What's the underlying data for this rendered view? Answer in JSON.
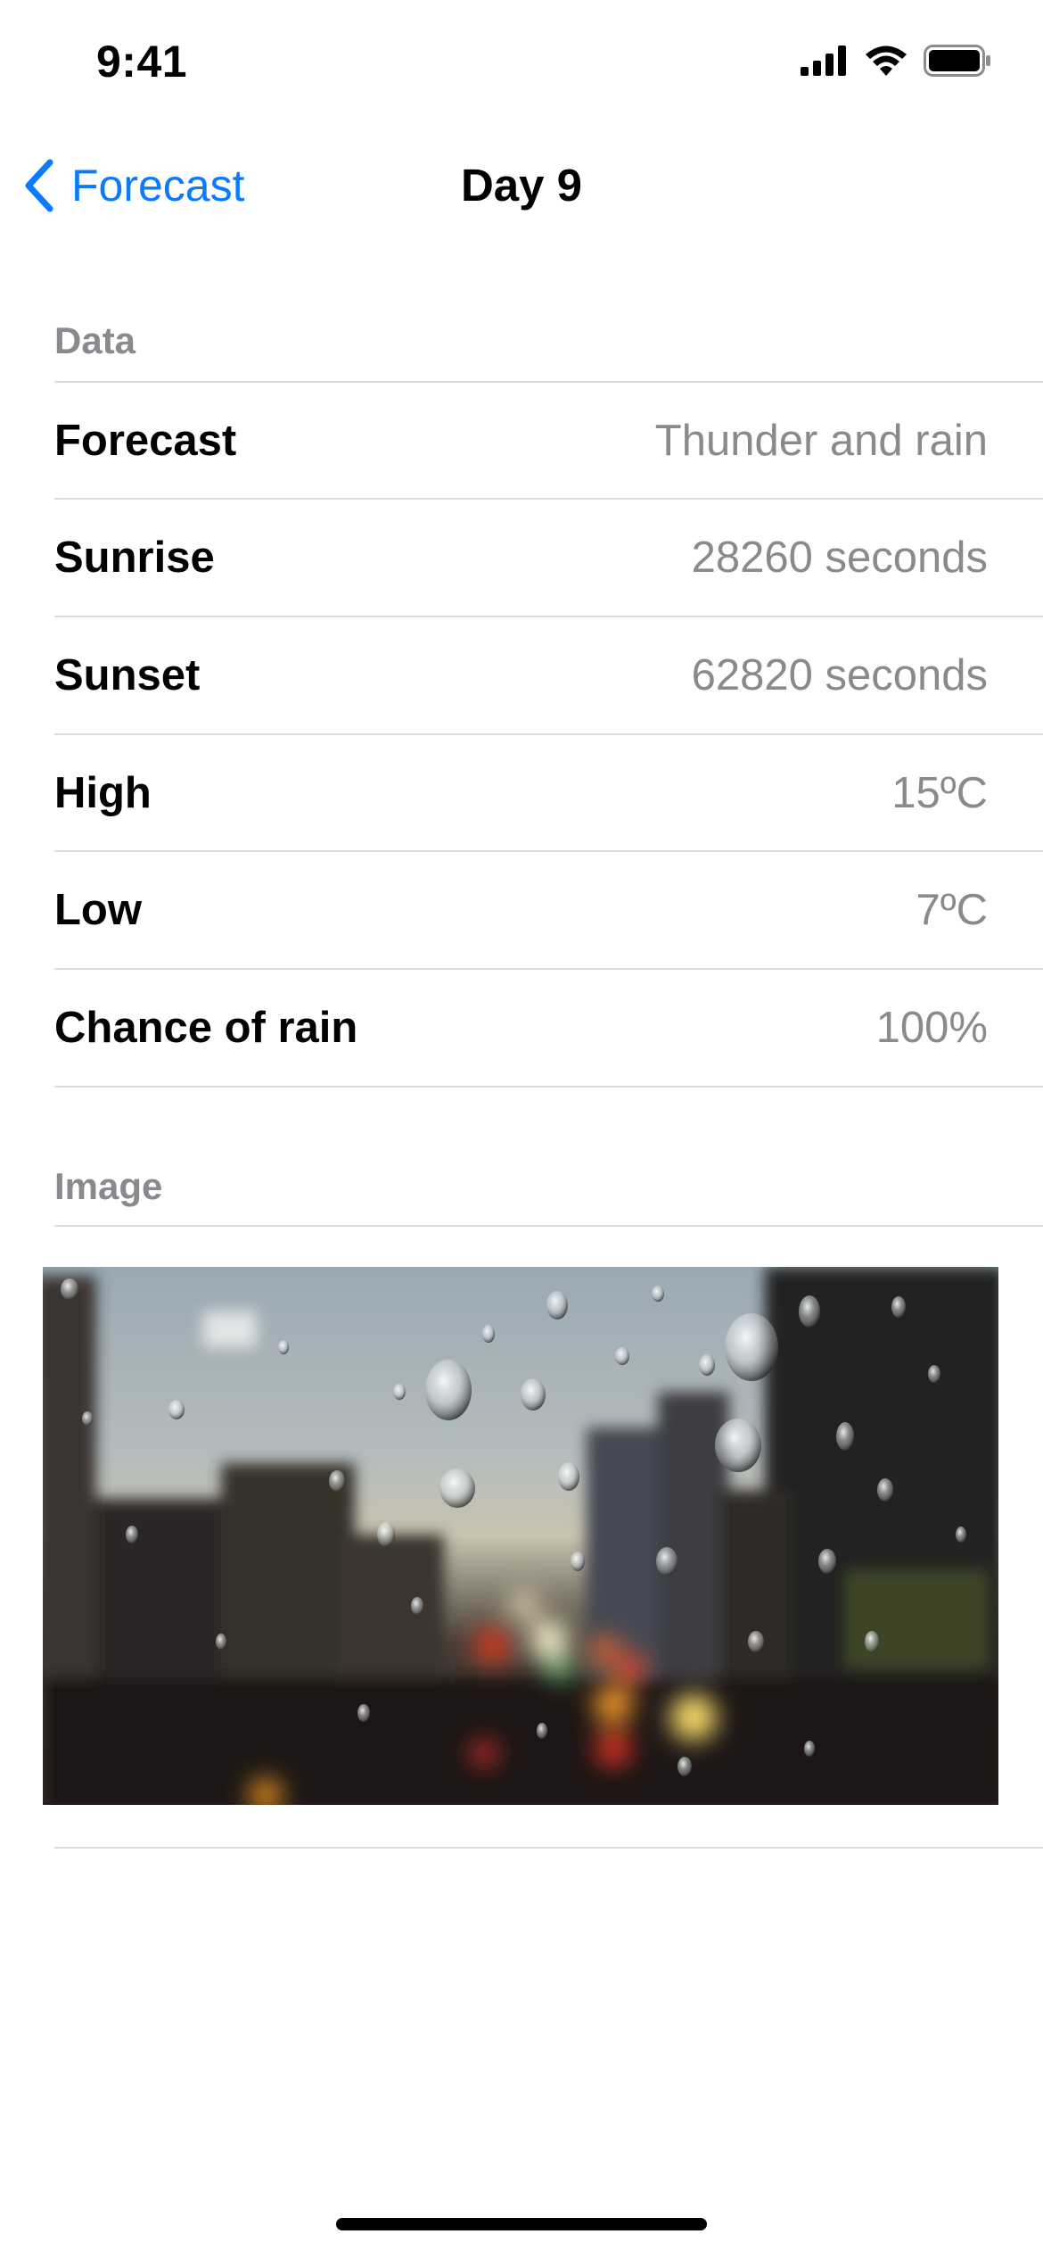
{
  "status_bar": {
    "time": "9:41",
    "icons": [
      "cellular-signal-icon",
      "wifi-icon",
      "battery-icon"
    ]
  },
  "nav": {
    "back_label": "Forecast",
    "title": "Day 9",
    "back_icon": "chevron-left-icon"
  },
  "colors": {
    "accent": "#0A7AFF",
    "secondary_text": "#8A8A8E",
    "separator": "#DCDCDF"
  },
  "data_section": {
    "header": "Data",
    "rows": [
      {
        "label": "Forecast",
        "value": "Thunder and rain"
      },
      {
        "label": "Sunrise",
        "value": "28260 seconds"
      },
      {
        "label": "Sunset",
        "value": "62820 seconds"
      },
      {
        "label": "High",
        "value": "15ºC"
      },
      {
        "label": "Low",
        "value": "7ºC"
      },
      {
        "label": "Chance of rain",
        "value": "100%"
      }
    ]
  },
  "image_section": {
    "header": "Image"
  }
}
